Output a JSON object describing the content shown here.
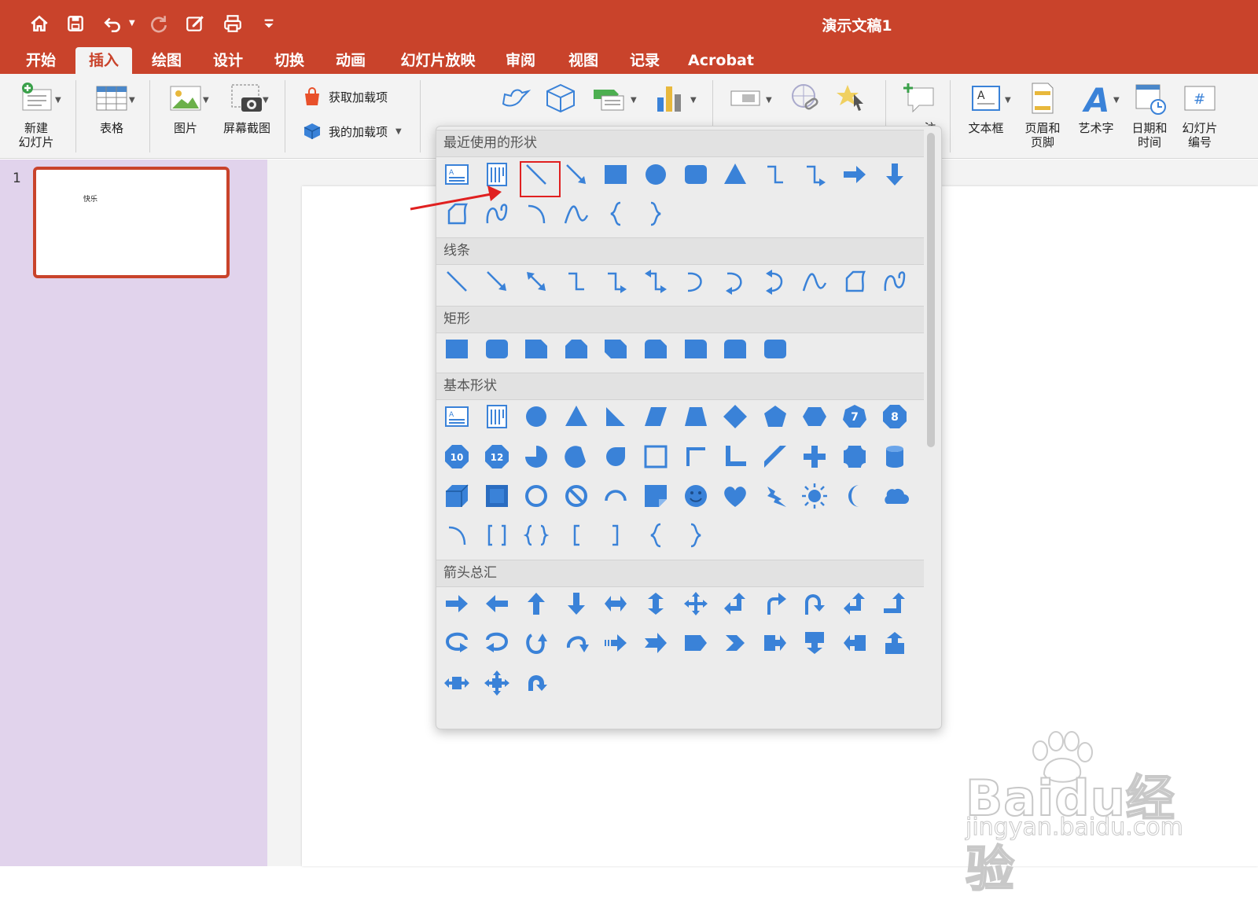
{
  "title_bar": {
    "title": "演示文稿1"
  },
  "quick_access": [
    "home-icon",
    "save-icon",
    "undo-icon",
    "redo-icon",
    "edit-icon",
    "print-icon",
    "customize-icon"
  ],
  "tabs": [
    "开始",
    "插入",
    "绘图",
    "设计",
    "切换",
    "动画",
    "幻灯片放映",
    "审阅",
    "视图",
    "记录",
    "Acrobat"
  ],
  "active_tab": "插入",
  "ribbon": {
    "new_slide": "新建\n幻灯片",
    "table": "表格",
    "picture": "图片",
    "screenshot": "屏幕截图",
    "get_addins": "获取加载项",
    "my_addins": "我的加载项",
    "comment_partial": "注",
    "textbox": "文本框",
    "header_footer": "页眉和\n页脚",
    "wordart": "艺术字",
    "date_time": "日期和\n时间",
    "slide_number": "幻灯片\n编号"
  },
  "slides_pane": {
    "slide_number": "1",
    "thumb_text": "快乐"
  },
  "gallery": {
    "sections": [
      {
        "title": "最近使用的形状"
      },
      {
        "title": "线条"
      },
      {
        "title": "矩形"
      },
      {
        "title": "基本形状"
      },
      {
        "title": "箭头总汇"
      }
    ],
    "selected_shape": "line",
    "octagon_labels": [
      "7",
      "8",
      "10",
      "12"
    ]
  },
  "watermark": {
    "line1": "Baidu经验",
    "line2": "jingyan.baidu.com"
  },
  "colors": {
    "accent": "#c9432b",
    "shape_blue": "#3a82d8",
    "pane": "#e1d3ec",
    "highlight": "#e02020"
  }
}
